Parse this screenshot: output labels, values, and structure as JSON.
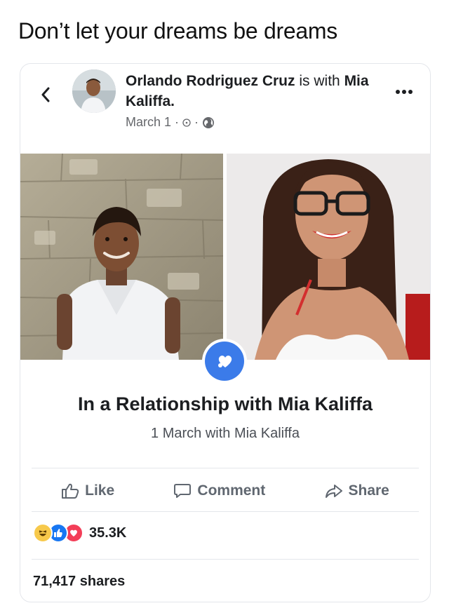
{
  "caption": "Don’t let your dreams be dreams",
  "post": {
    "author": "Orlando Rodriguez Cruz",
    "is_word": "is",
    "with_word": "with",
    "tagged": "Mia Kaliffa.",
    "date": "March 1",
    "sep": "·"
  },
  "event": {
    "title": "In a Relationship with Mia Kaliffa",
    "subtitle": "1 March with Mia Kaliffa"
  },
  "actions": {
    "like": "Like",
    "comment": "Comment",
    "share": "Share"
  },
  "reactions": {
    "count": "35.3K",
    "types": [
      "haha",
      "like",
      "love"
    ]
  },
  "shares": "71,417 shares",
  "colors": {
    "accent": "#3b7be9",
    "like_blue": "#1877f2",
    "love_red": "#f33e58",
    "haha_yellow": "#f7c94b",
    "action_gray": "#606770"
  }
}
